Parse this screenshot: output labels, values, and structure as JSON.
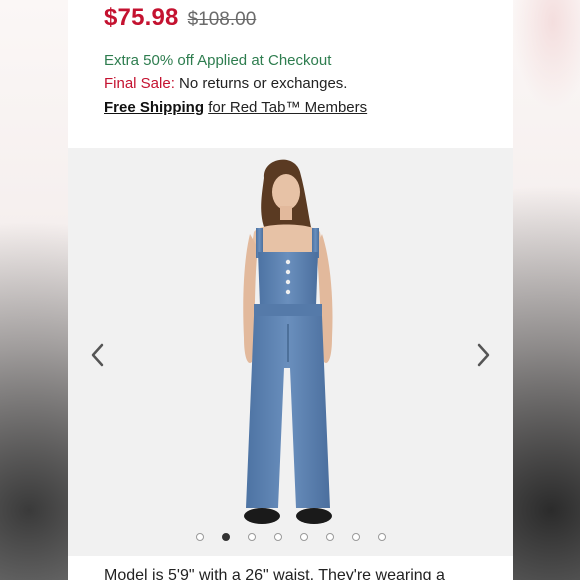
{
  "price": {
    "sale": "$75.98",
    "original": "$108.00"
  },
  "promo_text": "Extra 50% off Applied at Checkout",
  "final_sale": {
    "label": "Final Sale:",
    "text": "No returns or exchanges."
  },
  "shipping": {
    "link": "Free Shipping",
    "text": "for Red Tab™ Members"
  },
  "gallery": {
    "prev_icon": "chevron-left-icon",
    "next_icon": "chevron-right-icon",
    "dots_total": 8,
    "active_index": 1
  },
  "description": "Model is 5'9\" with a 26\" waist. They're wearing a",
  "colors": {
    "sale": "#c41230",
    "promo": "#2e7d4f",
    "denim": "#5a7fae"
  }
}
